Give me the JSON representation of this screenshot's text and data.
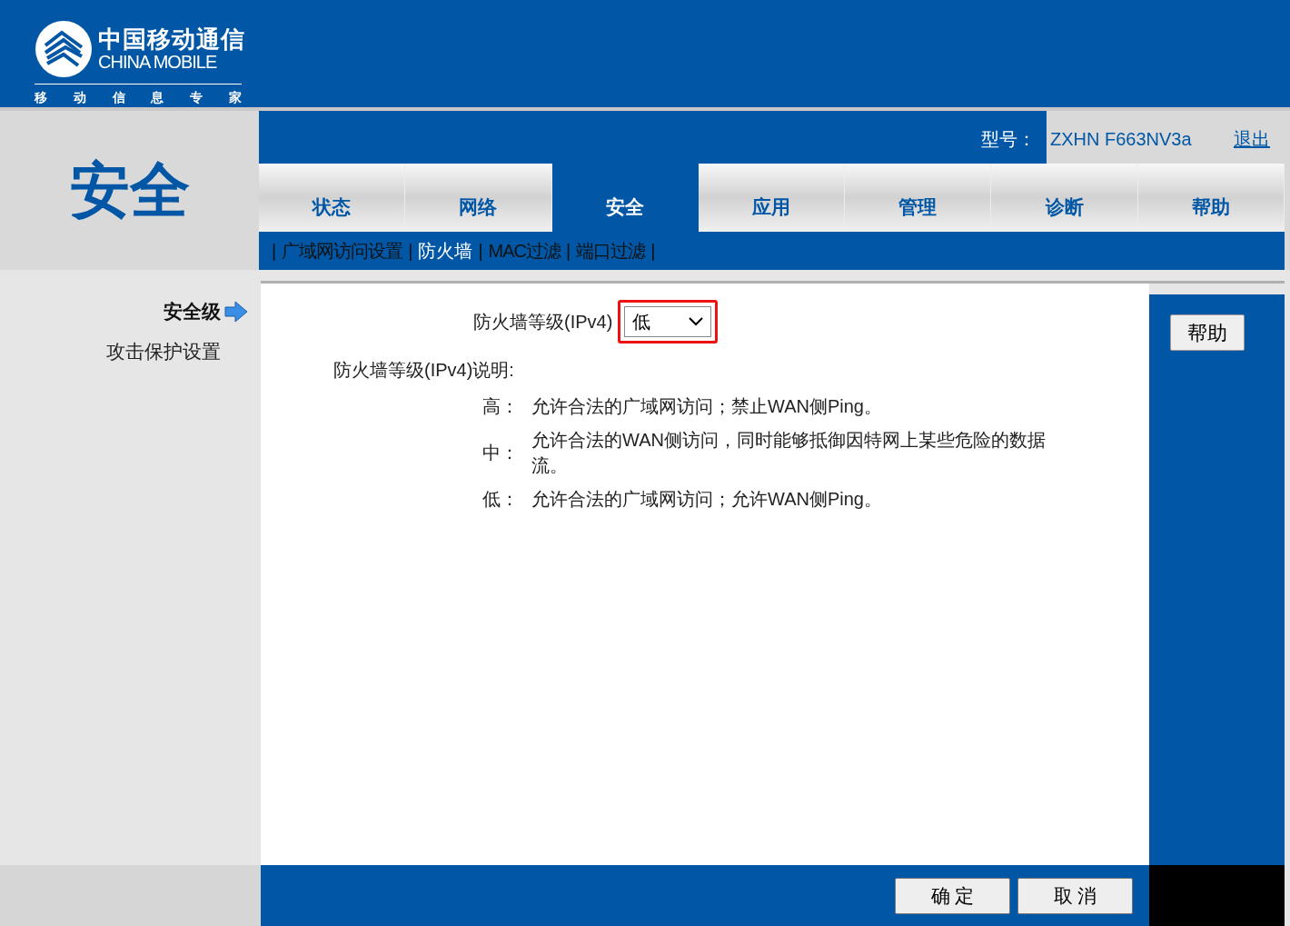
{
  "logo": {
    "name_cn": "中国移动通信",
    "name_en": "CHINA MOBILE",
    "slogan": [
      "移",
      "动",
      "信",
      "息",
      "专",
      "家"
    ]
  },
  "section_title": "安全",
  "model": {
    "label": "型号：",
    "value": "ZXHN F663NV3a"
  },
  "logout": "退出",
  "tabs": [
    {
      "label": "状态",
      "selected": false
    },
    {
      "label": "网络",
      "selected": false
    },
    {
      "label": "安全",
      "selected": true
    },
    {
      "label": "应用",
      "selected": false
    },
    {
      "label": "管理",
      "selected": false
    },
    {
      "label": "诊断",
      "selected": false
    },
    {
      "label": "帮助",
      "selected": false
    }
  ],
  "subnav_separator": "|",
  "subnav": [
    {
      "label": "广域网访问设置",
      "selected": false
    },
    {
      "label": "防火墙",
      "selected": true
    },
    {
      "label": "MAC过滤",
      "selected": false
    },
    {
      "label": "端口过滤",
      "selected": false
    }
  ],
  "sidebar": {
    "items": [
      {
        "label": "安全级",
        "selected": true
      },
      {
        "label": "攻击保护设置",
        "selected": false
      }
    ]
  },
  "firewall": {
    "label": "防火墙等级(IPv4)",
    "value": "低",
    "highlighted": true,
    "description_title": "防火墙等级(IPv4)说明:",
    "levels": [
      {
        "level": "高：",
        "text": "允许合法的广域网访问；禁止WAN侧Ping。"
      },
      {
        "level": "中：",
        "text": "允许合法的WAN侧访问，同时能够抵御因特网上某些危险的数据流。"
      },
      {
        "level": "低：",
        "text": "允许合法的广域网访问；允许WAN侧Ping。"
      }
    ]
  },
  "help_button": "帮助",
  "buttons": [
    "确 定",
    "取 消"
  ]
}
